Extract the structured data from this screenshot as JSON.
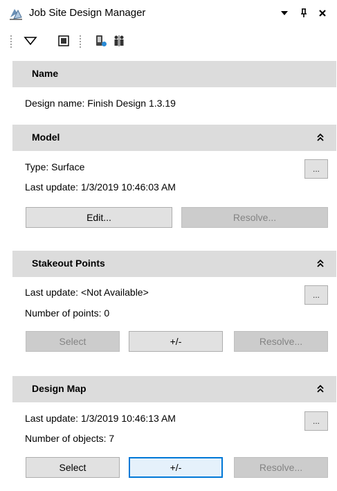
{
  "window": {
    "title": "Job Site Design Manager",
    "icons": {
      "app": "design-layers-icon",
      "menu": "dropdown-arrow-icon",
      "pin": "pin-icon",
      "close": "close-icon"
    }
  },
  "toolbar": {
    "icons": [
      "triangle-dropdown-icon",
      "square-view-icon",
      "device-settings-icon",
      "workers-icon"
    ]
  },
  "sections": {
    "name": {
      "header": "Name",
      "design_name": "Design name: Finish Design 1.3.19"
    },
    "model": {
      "header": "Model",
      "type": "Type: Surface",
      "last_update": "Last update: 1/3/2019 10:46:03 AM",
      "more": "...",
      "edit": "Edit...",
      "resolve": "Resolve..."
    },
    "stakeout": {
      "header": "Stakeout Points",
      "last_update": "Last update: <Not Available>",
      "count": "Number of points: 0",
      "more": "...",
      "select": "Select",
      "plusminus": "+/-",
      "resolve": "Resolve..."
    },
    "design_map": {
      "header": "Design Map",
      "last_update": "Last update: 1/3/2019 10:46:13 AM",
      "count": "Number of objects: 7",
      "more": "...",
      "select": "Select",
      "plusminus": "+/-",
      "resolve": "Resolve..."
    }
  },
  "colors": {
    "header_bg": "#dcdcdc",
    "button_bg": "#e1e1e1",
    "disabled_bg": "#cccccc",
    "focus": "#0078d7"
  }
}
